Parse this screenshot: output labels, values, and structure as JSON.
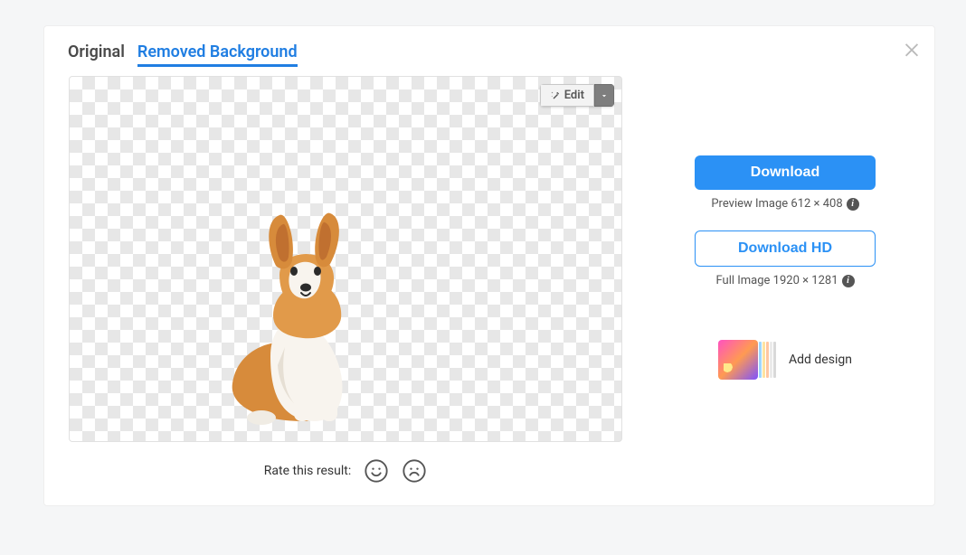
{
  "tabs": {
    "original": "Original",
    "removed": "Removed Background",
    "active": "removed"
  },
  "edit": {
    "label": "Edit"
  },
  "rate": {
    "label": "Rate this result:"
  },
  "actions": {
    "download": "Download",
    "preview_meta": "Preview Image 612 × 408",
    "download_hd": "Download HD",
    "full_meta": "Full Image 1920 × 1281",
    "add_design": "Add design"
  }
}
